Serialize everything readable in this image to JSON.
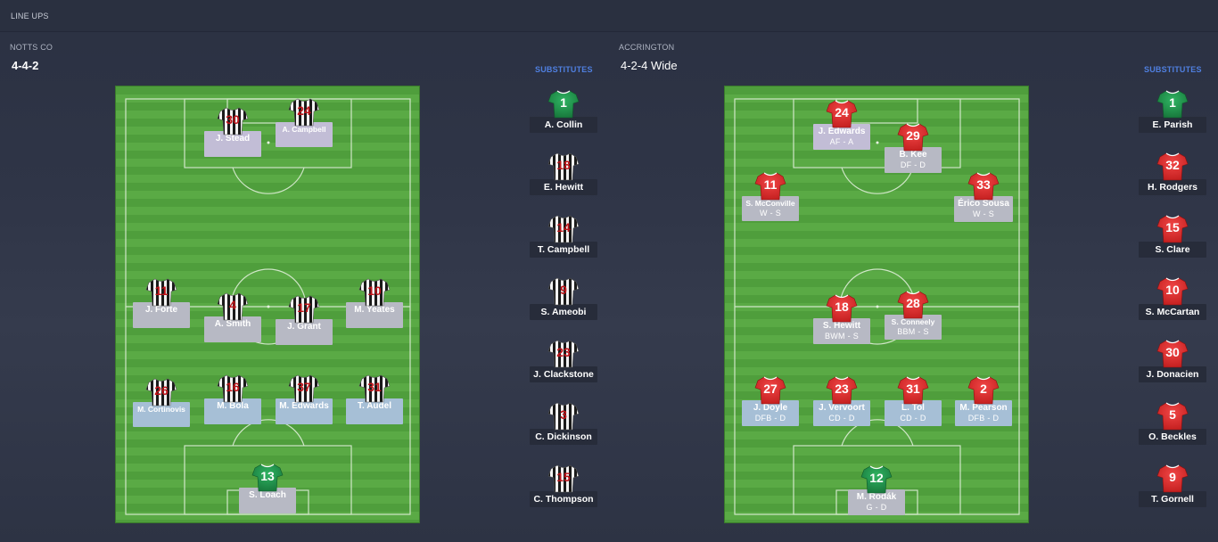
{
  "header": {
    "title": "LINE UPS"
  },
  "home": {
    "name": "NOTTS CO",
    "formation": "4-4-2",
    "subs_label": "SUBSTITUTES",
    "players": {
      "stead": {
        "number": "30",
        "name": "J. Stead"
      },
      "acampbell": {
        "number": "24",
        "name": "A. Campbell"
      },
      "forte": {
        "number": "11",
        "name": "J. Forte"
      },
      "smith": {
        "number": "4",
        "name": "A. Smith"
      },
      "grant": {
        "number": "17",
        "name": "J. Grant"
      },
      "yeates": {
        "number": "10",
        "name": "M. Yeates"
      },
      "cortinovis": {
        "number": "26",
        "name": "M. Cortinovis"
      },
      "bola": {
        "number": "16",
        "name": "M. Bola"
      },
      "edwards": {
        "number": "37",
        "name": "M. Edwards"
      },
      "audel": {
        "number": "31",
        "name": "T. Audel"
      },
      "loach": {
        "number": "13",
        "name": "S. Loach"
      }
    },
    "subs": [
      {
        "number": "1",
        "name": "A. Collin"
      },
      {
        "number": "18",
        "name": "E. Hewitt"
      },
      {
        "number": "14",
        "name": "T. Campbell"
      },
      {
        "number": "9",
        "name": "S. Ameobi"
      },
      {
        "number": "23",
        "name": "J. Clackstone"
      },
      {
        "number": "3",
        "name": "C. Dickinson"
      },
      {
        "number": "15",
        "name": "C. Thompson"
      }
    ]
  },
  "away": {
    "name": "ACCRINGTON",
    "formation": "4-2-4 Wide",
    "subs_label": "SUBSTITUTES",
    "players": {
      "jedwards": {
        "number": "24",
        "name": "J. Edwards",
        "role": "AF - A"
      },
      "kee": {
        "number": "29",
        "name": "B. Kee",
        "role": "DF - D"
      },
      "mcconville": {
        "number": "11",
        "name": "S. McConville",
        "role": "W - S"
      },
      "sousa": {
        "number": "33",
        "name": "Érico Sousa",
        "role": "W - S"
      },
      "hewitt": {
        "number": "18",
        "name": "S. Hewitt",
        "role": "BWM - S"
      },
      "conneely": {
        "number": "28",
        "name": "S. Conneely",
        "role": "BBM - S"
      },
      "doyle": {
        "number": "27",
        "name": "J. Doyle",
        "role": "DFB - D"
      },
      "vervoort": {
        "number": "23",
        "name": "J. Vervoort",
        "role": "CD - D"
      },
      "tol": {
        "number": "31",
        "name": "L. Tol",
        "role": "CD - D"
      },
      "pearson": {
        "number": "2",
        "name": "M. Pearson",
        "role": "DFB - D"
      },
      "rodak": {
        "number": "12",
        "name": "M. Rodák",
        "role": "G - D"
      }
    },
    "subs": [
      {
        "number": "1",
        "name": "E. Parish"
      },
      {
        "number": "32",
        "name": "H. Rodgers"
      },
      {
        "number": "15",
        "name": "S. Clare"
      },
      {
        "number": "10",
        "name": "S. McCartan"
      },
      {
        "number": "30",
        "name": "J. Donacien"
      },
      {
        "number": "5",
        "name": "O. Beckles"
      },
      {
        "number": "9",
        "name": "T. Gornell"
      }
    ]
  },
  "colors": {
    "accent_blue": "#4f7fe0",
    "pitch_green": "#5aaa45",
    "away_shirt_red": "#d92b2b",
    "gk_green": "#1f8a45"
  }
}
